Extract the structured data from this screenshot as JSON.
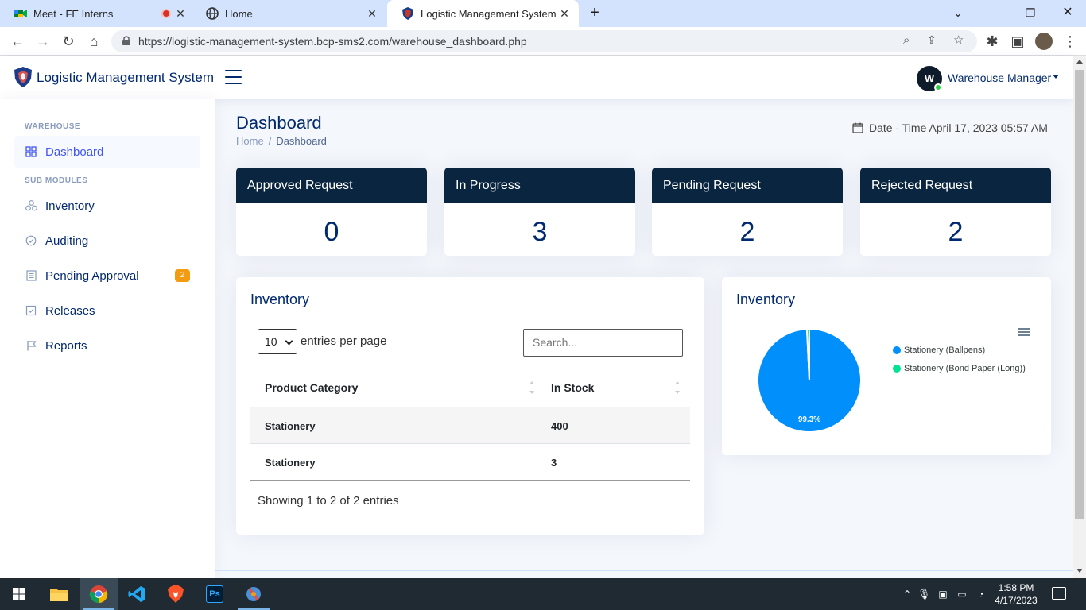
{
  "browser": {
    "tabs": [
      {
        "title": "Meet - FE Interns"
      },
      {
        "title": "Home"
      },
      {
        "title": "Logistic Management System"
      }
    ],
    "url": "https://logistic-management-system.bcp-sms2.com/warehouse_dashboard.php"
  },
  "header": {
    "brand": "Logistic Management System",
    "avatar_initial": "W",
    "user_name": "Warehouse Manager"
  },
  "sidebar": {
    "section_warehouse": "WAREHOUSE",
    "section_sub": "SUB MODULES",
    "items": [
      {
        "label": "Dashboard",
        "icon": "grid-icon"
      },
      {
        "label": "Inventory",
        "icon": "boxes-icon"
      },
      {
        "label": "Auditing",
        "icon": "check-circle-icon"
      },
      {
        "label": "Pending Approval",
        "icon": "list-icon",
        "badge": "2"
      },
      {
        "label": "Releases",
        "icon": "check-square-icon"
      },
      {
        "label": "Reports",
        "icon": "flag-icon"
      }
    ]
  },
  "page": {
    "title": "Dashboard",
    "breadcrumb": [
      "Home",
      "Dashboard"
    ],
    "datetime": "Date - Time April 17, 2023 05:57 AM"
  },
  "stats": [
    {
      "label": "Approved Request",
      "value": "0"
    },
    {
      "label": "In Progress",
      "value": "3"
    },
    {
      "label": "Pending Request",
      "value": "2"
    },
    {
      "label": "Rejected Request",
      "value": "2"
    }
  ],
  "inventory_table": {
    "title": "Inventory",
    "per_page": "10",
    "per_page_label": "entries per page",
    "search_placeholder": "Search...",
    "columns": [
      "Product Category",
      "In Stock"
    ],
    "rows": [
      [
        "Stationery",
        "400"
      ],
      [
        "Stationery",
        "3"
      ]
    ],
    "showing": "Showing 1 to 2 of 2 entries"
  },
  "inventory_chart": {
    "title": "Inventory",
    "chart_data": {
      "type": "pie",
      "categories": [
        "Stationery (Ballpens)",
        "Stationery (Bond Paper (Long))"
      ],
      "values": [
        400,
        3
      ],
      "data_labels": [
        "99.3%"
      ],
      "colors": [
        "#008ffb",
        "#00e396"
      ],
      "legend": "right"
    }
  },
  "taskbar": {
    "time": "1:58 PM",
    "date": "4/17/2023"
  }
}
